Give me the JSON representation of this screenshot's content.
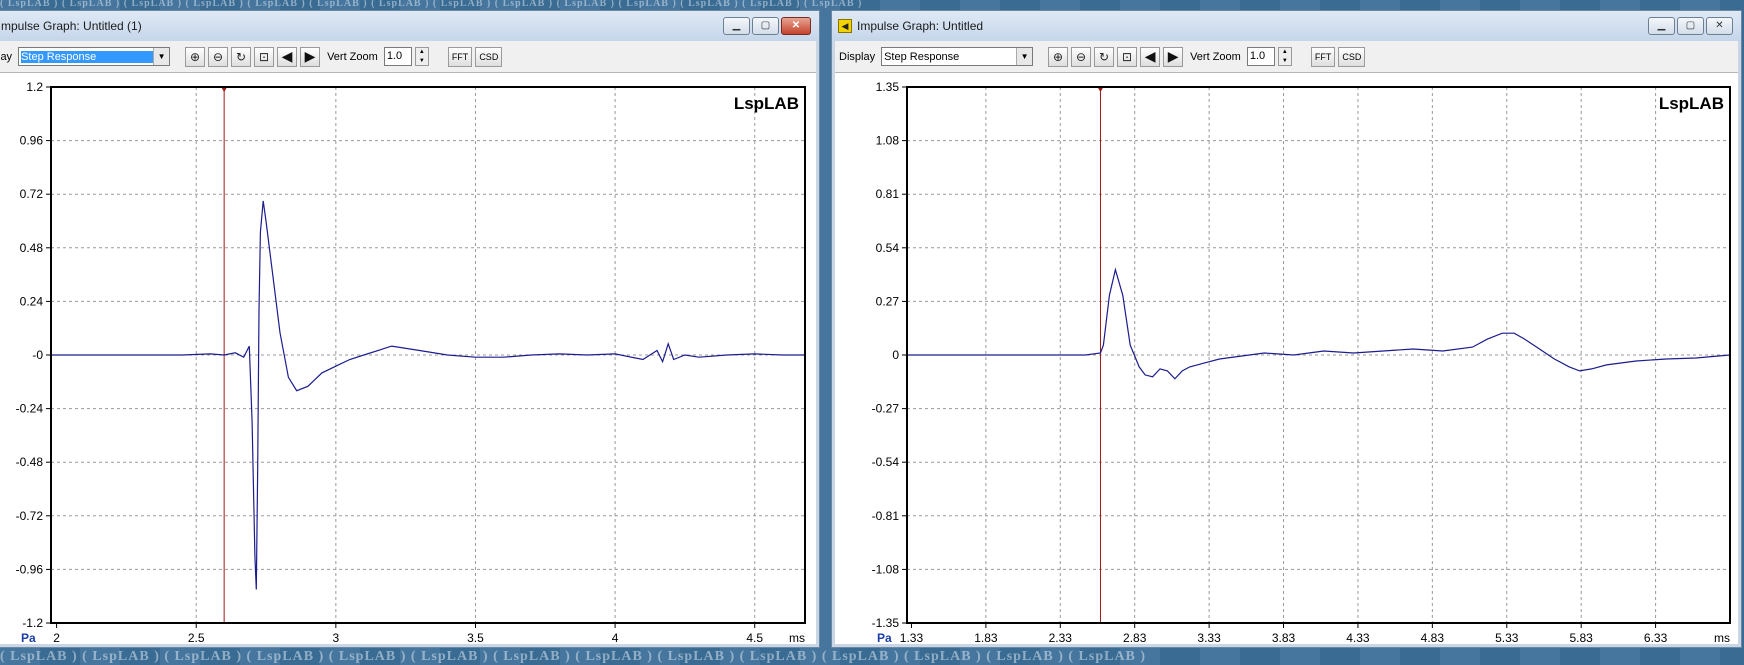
{
  "background": {
    "watermark": "( LspLAB ) ( LspLAB ) ( LspLAB ) ( LspLAB ) ( LspLAB ) ( LspLAB ) ( LspLAB ) ( LspLAB ) ( LspLAB ) ( LspLAB ) ( LspLAB ) ( LspLAB ) ( LspLAB ) ( LspLAB )"
  },
  "windows": [
    {
      "title": "mpulse Graph: Untitled (1)",
      "show_icon": false,
      "display_label": "lay",
      "display_value": "Step Response",
      "vert_zoom_label": "Vert Zoom",
      "vert_zoom_value": "1.0",
      "fft_label": "FFT",
      "csd_label": "CSD",
      "controls": {
        "minimize": "▁",
        "maximize": "▢",
        "close": "✕"
      }
    },
    {
      "title": "Impulse Graph: Untitled",
      "show_icon": true,
      "display_label": "Display",
      "display_value": "Step Response",
      "vert_zoom_label": "Vert Zoom",
      "vert_zoom_value": "1.0",
      "fft_label": "FFT",
      "csd_label": "CSD",
      "controls": {
        "minimize": "▁",
        "maximize": "▢",
        "close": "✕"
      }
    }
  ],
  "colors": {
    "trace": "#1c1c8e",
    "cursor": "#a01818",
    "grid": "#9a9a9a",
    "unit_label": "#1a3ea8"
  },
  "chart_data": [
    {
      "type": "line",
      "title": "",
      "watermark": "LspLAB",
      "xlabel": "ms",
      "ylabel": "Pa",
      "xlim": [
        1.98,
        4.68
      ],
      "ylim": [
        -1.2,
        1.2
      ],
      "xticks": [
        2,
        2.5,
        3,
        3.5,
        4,
        4.5
      ],
      "xtick_labels": [
        "2",
        "2.5",
        "3",
        "3.5",
        "4",
        "4.5"
      ],
      "yticks": [
        1.2,
        0.96,
        0.72,
        0.48,
        0.24,
        0,
        -0.24,
        -0.48,
        -0.72,
        -0.96,
        -1.2
      ],
      "ytick_labels": [
        "1.2",
        "0.96",
        "0.72",
        "0.48",
        "0.24",
        "-0",
        "-0.24",
        "-0.48",
        "-0.72",
        "-0.96",
        "-1.2"
      ],
      "grid": true,
      "cursor_x": 2.6,
      "series": [
        {
          "x": [
            1.98,
            2.45,
            2.55,
            2.6,
            2.64,
            2.67,
            2.69,
            2.7,
            2.71,
            2.715,
            2.72,
            2.725,
            2.73,
            2.74,
            2.75,
            2.77,
            2.8,
            2.83,
            2.86,
            2.9,
            2.95,
            3.0,
            3.05,
            3.1,
            3.2,
            3.3,
            3.4,
            3.5,
            3.6,
            3.7,
            3.8,
            3.9,
            4.0,
            4.1,
            4.15,
            4.17,
            4.19,
            4.21,
            4.25,
            4.3,
            4.4,
            4.5,
            4.6,
            4.68
          ],
          "y": [
            0,
            0,
            0.005,
            0,
            0.01,
            -0.01,
            0.04,
            -0.3,
            -0.9,
            -1.05,
            -0.5,
            0.2,
            0.55,
            0.69,
            0.6,
            0.4,
            0.1,
            -0.1,
            -0.16,
            -0.14,
            -0.08,
            -0.05,
            -0.02,
            0.0,
            0.04,
            0.02,
            0.0,
            -0.01,
            -0.01,
            0.0,
            0.005,
            0.0,
            0.005,
            -0.02,
            0.02,
            -0.03,
            0.05,
            -0.02,
            0.0,
            -0.01,
            0.0,
            0.005,
            0.0,
            0.0
          ]
        }
      ]
    },
    {
      "type": "line",
      "title": "",
      "watermark": "LspLAB",
      "xlabel": "ms",
      "ylabel": "Pa",
      "xlim": [
        1.3,
        6.83
      ],
      "ylim": [
        -1.35,
        1.35
      ],
      "xticks": [
        1.33,
        1.83,
        2.33,
        2.83,
        3.33,
        3.83,
        4.33,
        4.83,
        5.33,
        5.83,
        6.33
      ],
      "xtick_labels": [
        "1.33",
        "1.83",
        "2.33",
        "2.83",
        "3.33",
        "3.83",
        "4.33",
        "4.83",
        "5.33",
        "5.83",
        "6.33"
      ],
      "yticks": [
        1.35,
        1.08,
        0.81,
        0.54,
        0.27,
        0,
        -0.27,
        -0.54,
        -0.81,
        -1.08,
        -1.35
      ],
      "ytick_labels": [
        "1.35",
        "1.08",
        "0.81",
        "0.54",
        "0.27",
        "0",
        "-0.27",
        "-0.54",
        "-0.81",
        "-1.08",
        "-1.35"
      ],
      "grid": true,
      "cursor_x": 2.6,
      "series": [
        {
          "x": [
            1.3,
            2.5,
            2.6,
            2.62,
            2.66,
            2.7,
            2.75,
            2.8,
            2.86,
            2.9,
            2.95,
            3.0,
            3.05,
            3.1,
            3.15,
            3.2,
            3.3,
            3.4,
            3.5,
            3.7,
            3.9,
            4.1,
            4.3,
            4.5,
            4.7,
            4.9,
            5.1,
            5.2,
            5.3,
            5.38,
            5.45,
            5.55,
            5.65,
            5.75,
            5.82,
            5.9,
            6.0,
            6.2,
            6.4,
            6.6,
            6.83
          ],
          "y": [
            0,
            0,
            0.01,
            0.05,
            0.3,
            0.43,
            0.3,
            0.05,
            -0.06,
            -0.1,
            -0.11,
            -0.07,
            -0.08,
            -0.12,
            -0.08,
            -0.06,
            -0.04,
            -0.02,
            -0.01,
            0.01,
            0.0,
            0.02,
            0.01,
            0.02,
            0.03,
            0.02,
            0.04,
            0.08,
            0.11,
            0.11,
            0.08,
            0.03,
            -0.02,
            -0.06,
            -0.08,
            -0.07,
            -0.05,
            -0.03,
            -0.02,
            -0.015,
            0.0
          ]
        }
      ]
    }
  ]
}
